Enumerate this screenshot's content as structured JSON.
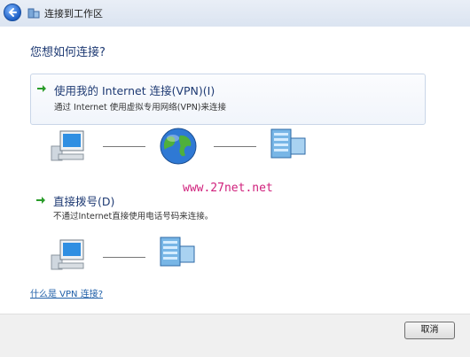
{
  "window": {
    "title": "连接到工作区"
  },
  "heading": "您想如何连接?",
  "options": [
    {
      "title": "使用我的 Internet 连接(VPN)(I)",
      "description": "通过 Internet 使用虚拟专用网络(VPN)来连接"
    },
    {
      "title": "直接拨号(D)",
      "description": "不通过Internet直接使用电话号码来连接。"
    }
  ],
  "watermark": "www.27net.net",
  "help_link": "什么是 VPN 连接?",
  "buttons": {
    "cancel": "取消"
  },
  "icons": [
    "back-icon",
    "network-icon",
    "computer-icon",
    "globe-icon",
    "server-icon",
    "green-arrow-icon"
  ]
}
